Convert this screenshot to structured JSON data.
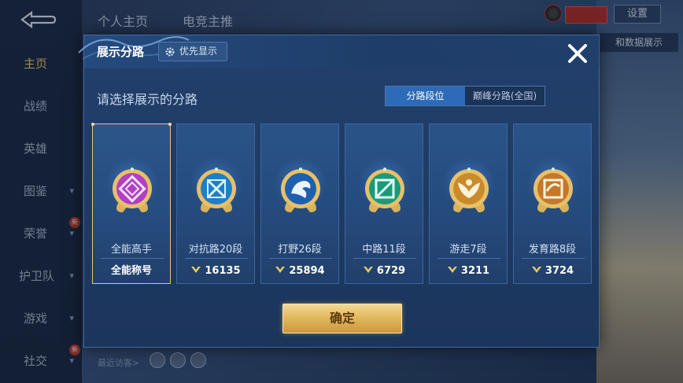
{
  "background": {
    "nav": [
      {
        "label": "主页",
        "active": true
      },
      {
        "label": "战绩"
      },
      {
        "label": "英雄"
      },
      {
        "label": "图鉴",
        "chevron": true
      },
      {
        "label": "荣誉",
        "chevron": true,
        "badge": "新"
      },
      {
        "label": "护卫队",
        "chevron": true
      },
      {
        "label": "游戏",
        "chevron": true
      },
      {
        "label": "社交",
        "chevron": true,
        "badge": "新"
      }
    ],
    "tabs": [
      "个人主页",
      "电竞主推"
    ],
    "settings_label": "设置",
    "data_tag": "和数据展示",
    "recent_visitors": "最近访客>"
  },
  "dialog": {
    "title": "展示分路",
    "priority_label": "优先显示",
    "subtitle": "请选择展示的分路",
    "segments": [
      {
        "label": "分路段位",
        "active": true
      },
      {
        "label": "巅峰分路(全国)",
        "active": false
      }
    ],
    "cards": [
      {
        "name": "全能高手",
        "footer": "全能称号",
        "score": null,
        "selected": true,
        "badge_color": "#b23fc4",
        "icon": "all-round-icon"
      },
      {
        "name": "对抗路20段",
        "footer": "16135",
        "score": 16135,
        "selected": false,
        "badge_color": "#1e7fc8",
        "icon": "clash-lane-icon"
      },
      {
        "name": "打野26段",
        "footer": "25894",
        "score": 25894,
        "selected": false,
        "badge_color": "#1f5fb0",
        "icon": "jungle-icon"
      },
      {
        "name": "中路11段",
        "footer": "6729",
        "score": 6729,
        "selected": false,
        "badge_color": "#1a9a78",
        "icon": "mid-lane-icon"
      },
      {
        "name": "游走7段",
        "footer": "3211",
        "score": 3211,
        "selected": false,
        "badge_color": "#c98a2c",
        "icon": "roam-icon"
      },
      {
        "name": "发育路8段",
        "footer": "3724",
        "score": 3724,
        "selected": false,
        "badge_color": "#c4782a",
        "icon": "farm-lane-icon"
      }
    ],
    "confirm_label": "确定"
  }
}
